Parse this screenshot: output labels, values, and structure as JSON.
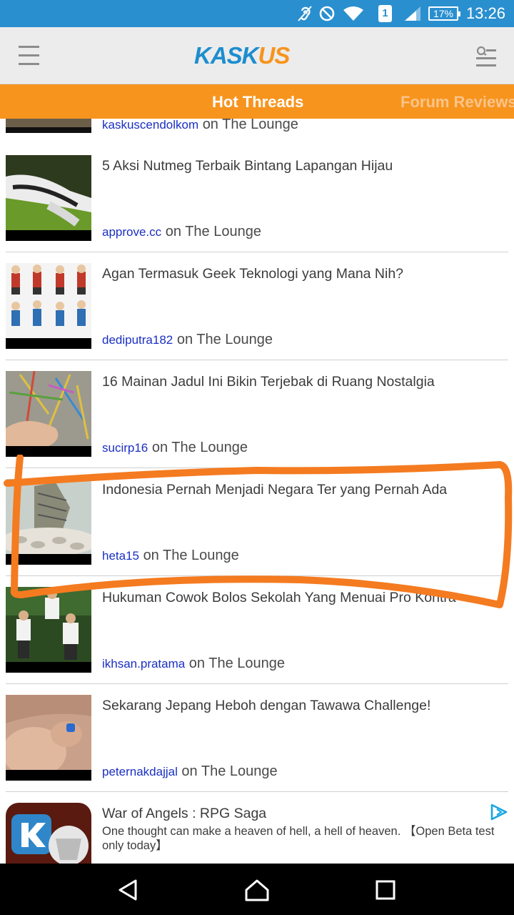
{
  "status_bar": {
    "time": "13:26",
    "battery": "17%",
    "sim": "1",
    "icons": [
      "hearing-aid-icon",
      "do-not-disturb-icon",
      "wifi-icon",
      "sim-icon",
      "signal-icon",
      "battery-icon"
    ]
  },
  "app_bar": {
    "logo_k": "K",
    "logo_blue": "ASK",
    "logo_orange": "US",
    "icons": [
      "menu-icon",
      "search-menu-icon"
    ]
  },
  "tabs": [
    {
      "label": "Hot Threads",
      "active": true
    },
    {
      "label": "Forum Reviews",
      "active": false
    }
  ],
  "threads": [
    {
      "title": "",
      "user": "kaskuscendolkom",
      "on": "on",
      "forum": "The Lounge",
      "partial": true
    },
    {
      "title": "5 Aksi Nutmeg Terbaik Bintang Lapangan Hijau",
      "user": "approve.cc",
      "on": "on",
      "forum": "The Lounge"
    },
    {
      "title": "Agan Termasuk Geek Teknologi yang Mana Nih?",
      "user": "dediputra182",
      "on": "on",
      "forum": "The Lounge"
    },
    {
      "title": "16 Mainan Jadul Ini Bikin Terjebak di Ruang Nostalgia",
      "user": "sucirp16",
      "on": "on",
      "forum": "The Lounge"
    },
    {
      "title": "Indonesia Pernah Menjadi Negara Ter yang Pernah Ada",
      "user": "heta15",
      "on": "on",
      "forum": "The Lounge"
    },
    {
      "title": "Hukuman Cowok Bolos Sekolah Yang Menuai Pro Kontra",
      "user": "ikhsan.pratama",
      "on": "on",
      "forum": "The Lounge"
    },
    {
      "title": "Sekarang Jepang Heboh dengan Tawawa Challenge!",
      "user": "peternakdajjal",
      "on": "on",
      "forum": "The Lounge"
    }
  ],
  "ad": {
    "title": "War of Angels : RPG Saga",
    "description": "One thought can make a heaven of hell, a hell of heaven. 【Open Beta test only today】",
    "icon": "adchoices-icon"
  },
  "nav_bar": {
    "icons": [
      "back-icon",
      "home-icon",
      "recents-icon"
    ]
  },
  "colors": {
    "status_bar": "#2a8fcf",
    "tab_bar": "#f7941e",
    "username": "#1a2fc2",
    "highlight": "#f47b20"
  }
}
